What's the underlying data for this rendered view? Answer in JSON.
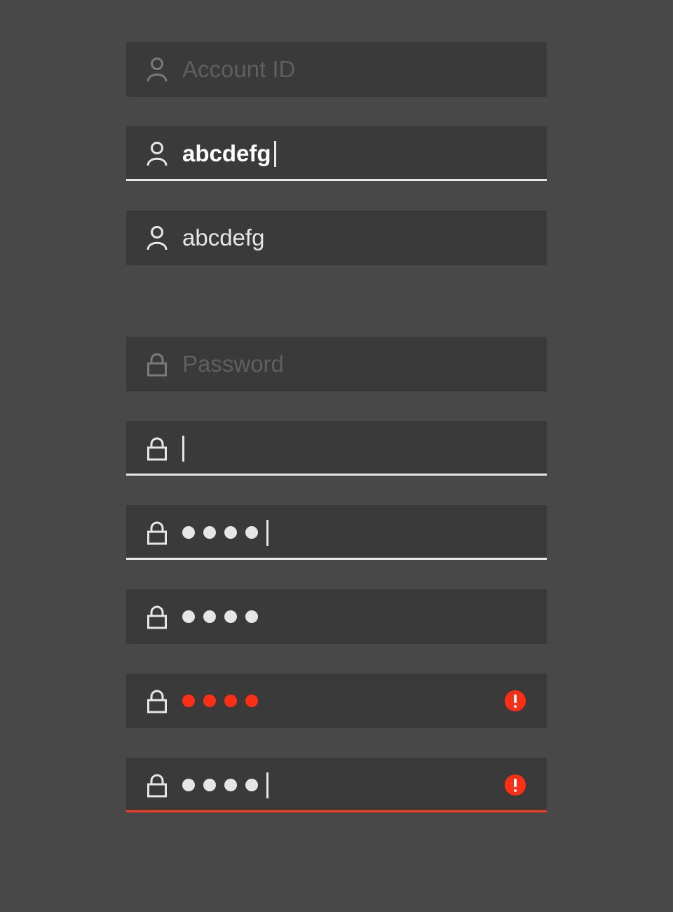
{
  "account_fields": [
    {
      "state": "placeholder",
      "icon": "user-icon",
      "placeholder": "Account ID",
      "value": ""
    },
    {
      "state": "focused",
      "icon": "user-icon",
      "value": "abcdefg"
    },
    {
      "state": "filled",
      "icon": "user-icon",
      "value": "abcdefg"
    }
  ],
  "password_fields": [
    {
      "state": "placeholder",
      "icon": "lock-icon",
      "placeholder": "Password",
      "masked_count": 0
    },
    {
      "state": "focused-empty",
      "icon": "lock-icon",
      "masked_count": 0
    },
    {
      "state": "focused",
      "icon": "lock-icon",
      "masked_count": 4
    },
    {
      "state": "filled",
      "icon": "lock-icon",
      "masked_count": 4
    },
    {
      "state": "error",
      "icon": "lock-icon",
      "masked_count": 4,
      "alert_icon": "alert-icon"
    },
    {
      "state": "error-focused",
      "icon": "lock-icon",
      "masked_count": 4,
      "alert_icon": "alert-icon"
    }
  ],
  "colors": {
    "background": "#484848",
    "field": "#3a3a3a",
    "text": "#e6e6e6",
    "placeholder": "#5f5f5f",
    "focus_underline": "#e8e8e8",
    "error": "#ff2e14"
  }
}
